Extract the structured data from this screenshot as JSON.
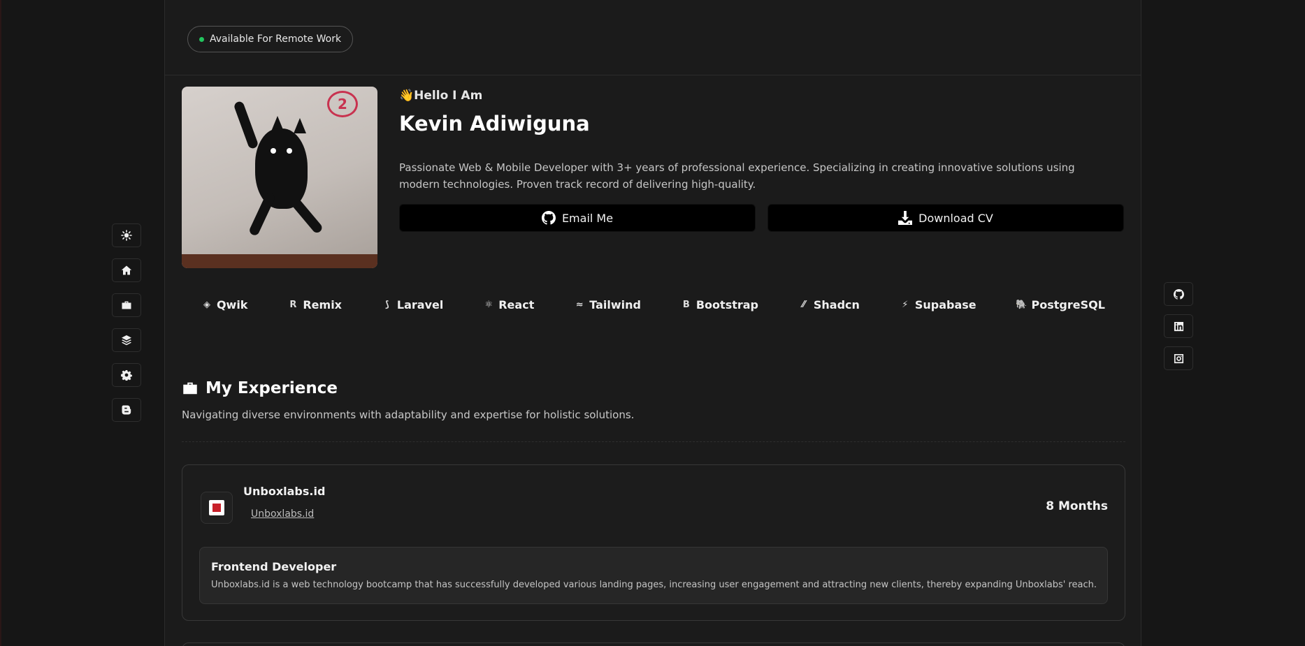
{
  "status_badge": {
    "label": "Available For Remote Work",
    "dot_color": "#22c55e"
  },
  "hero": {
    "greeting_emoji": "👋",
    "greeting": "Hello I Am",
    "name": "Kevin Adiwiguna",
    "description": "Passionate Web & Mobile Developer with 3+ years of professional experience. Specializing in creating innovative solutions using modern technologies. Proven track record of delivering high-quality.",
    "email_button": "Email Me",
    "cv_button": "Download CV",
    "avatar_badge": "2"
  },
  "tech_stack": [
    {
      "label": "Qwik",
      "icon": "qwik-icon",
      "glyph": "◈"
    },
    {
      "label": "Remix",
      "icon": "remix-icon",
      "glyph": "R"
    },
    {
      "label": "Laravel",
      "icon": "laravel-icon",
      "glyph": "⟆"
    },
    {
      "label": "React",
      "icon": "react-icon",
      "glyph": "⚛"
    },
    {
      "label": "Tailwind",
      "icon": "tailwind-icon",
      "glyph": "≈"
    },
    {
      "label": "Bootstrap",
      "icon": "bootstrap-icon",
      "glyph": "B"
    },
    {
      "label": "Shadcn",
      "icon": "shadcn-icon",
      "glyph": "⁄⁄"
    },
    {
      "label": "Supabase",
      "icon": "supabase-icon",
      "glyph": "⚡"
    },
    {
      "label": "PostgreSQL",
      "icon": "postgresql-icon",
      "glyph": "🐘"
    }
  ],
  "experience": {
    "title": "My Experience",
    "subtitle": "Navigating diverse environments with adaptability and expertise for holistic solutions.",
    "items": [
      {
        "company": "Unboxlabs.id",
        "link_text": "Unboxlabs.id",
        "duration": "8 Months",
        "role": "Frontend Developer",
        "role_description": "Unboxlabs.id is a web technology bootcamp that has successfully developed various landing pages, increasing user engagement and attracting new clients, thereby expanding Unboxlabs' reach."
      }
    ]
  },
  "side_nav": [
    {
      "name": "theme-toggle",
      "icon": "sun-icon"
    },
    {
      "name": "home",
      "icon": "home-icon"
    },
    {
      "name": "experience",
      "icon": "briefcase-icon"
    },
    {
      "name": "projects",
      "icon": "layers-icon"
    },
    {
      "name": "settings",
      "icon": "gear-icon"
    },
    {
      "name": "blog",
      "icon": "blogger-icon"
    }
  ],
  "social_links": [
    {
      "name": "github",
      "icon": "github-icon"
    },
    {
      "name": "linkedin",
      "icon": "linkedin-icon"
    },
    {
      "name": "instagram",
      "icon": "instagram-icon"
    }
  ]
}
